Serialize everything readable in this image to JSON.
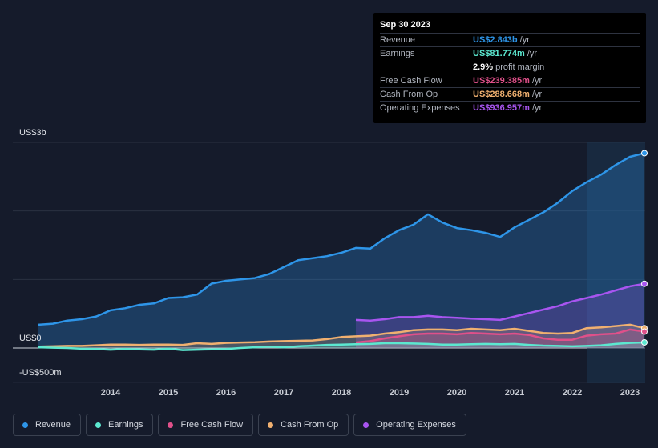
{
  "tooltip": {
    "date": "Sep 30 2023",
    "rows": [
      {
        "label": "Revenue",
        "value": "US$2.843b",
        "unit": "/yr",
        "color": "#2e95e8"
      },
      {
        "label": "Earnings",
        "value": "US$81.774m",
        "unit": "/yr",
        "color": "#5ce8d0"
      },
      {
        "label": "",
        "value": "2.9%",
        "unit": "profit margin",
        "color": "#ffffff"
      },
      {
        "label": "Free Cash Flow",
        "value": "US$239.385m",
        "unit": "/yr",
        "color": "#e0508a"
      },
      {
        "label": "Cash From Op",
        "value": "US$288.668m",
        "unit": "/yr",
        "color": "#f0b070"
      },
      {
        "label": "Operating Expenses",
        "value": "US$936.957m",
        "unit": "/yr",
        "color": "#a855f0"
      }
    ]
  },
  "legend": [
    {
      "label": "Revenue",
      "color": "#2e95e8"
    },
    {
      "label": "Earnings",
      "color": "#5ce8d0"
    },
    {
      "label": "Free Cash Flow",
      "color": "#e0508a"
    },
    {
      "label": "Cash From Op",
      "color": "#f0b070"
    },
    {
      "label": "Operating Expenses",
      "color": "#a855f0"
    }
  ],
  "chart_data": {
    "type": "area",
    "title": "",
    "xlabel": "",
    "ylabel": "",
    "y_tick_labels": [
      "US$3b",
      "US$0",
      "-US$500m"
    ],
    "x_tick_labels": [
      "2014",
      "2015",
      "2016",
      "2017",
      "2018",
      "2019",
      "2020",
      "2021",
      "2022",
      "2023"
    ],
    "ylim": [
      -500,
      3000
    ],
    "xlim": [
      2013.25,
      2023.75
    ],
    "grid": true,
    "legend_position": "bottom",
    "highlight_from": 2022.75,
    "series": [
      {
        "name": "Revenue",
        "color": "#2e95e8",
        "x": [
          2013.25,
          2013.5,
          2013.75,
          2014,
          2014.25,
          2014.5,
          2014.75,
          2015,
          2015.25,
          2015.5,
          2015.75,
          2016,
          2016.25,
          2016.5,
          2016.75,
          2017,
          2017.25,
          2017.5,
          2017.75,
          2018,
          2018.25,
          2018.5,
          2018.75,
          2019,
          2019.25,
          2019.5,
          2019.75,
          2020,
          2020.25,
          2020.5,
          2020.75,
          2021,
          2021.25,
          2021.5,
          2021.75,
          2022,
          2022.25,
          2022.5,
          2022.75,
          2023,
          2023.25,
          2023.5,
          2023.75
        ],
        "values": [
          340,
          355,
          400,
          420,
          460,
          550,
          580,
          630,
          650,
          730,
          740,
          780,
          940,
          980,
          1000,
          1020,
          1080,
          1180,
          1280,
          1310,
          1340,
          1390,
          1460,
          1450,
          1600,
          1720,
          1800,
          1950,
          1830,
          1750,
          1720,
          1680,
          1620,
          1760,
          1870,
          1980,
          2120,
          2290,
          2420,
          2530,
          2670,
          2790,
          2843
        ]
      },
      {
        "name": "Earnings",
        "color": "#5ce8d0",
        "x": [
          2013.25,
          2013.5,
          2013.75,
          2014,
          2014.25,
          2014.5,
          2014.75,
          2015,
          2015.25,
          2015.5,
          2015.75,
          2016,
          2016.25,
          2016.5,
          2016.75,
          2017,
          2017.25,
          2017.5,
          2017.75,
          2018,
          2018.25,
          2018.5,
          2018.75,
          2019,
          2019.25,
          2019.5,
          2019.75,
          2020,
          2020.25,
          2020.5,
          2020.75,
          2021,
          2021.25,
          2021.5,
          2021.75,
          2022,
          2022.25,
          2022.5,
          2022.75,
          2023,
          2023.25,
          2023.5,
          2023.75
        ],
        "values": [
          10,
          5,
          0,
          -10,
          -15,
          -25,
          -15,
          -20,
          -25,
          -10,
          -30,
          -25,
          -20,
          -15,
          0,
          10,
          20,
          10,
          25,
          35,
          45,
          50,
          55,
          60,
          70,
          70,
          65,
          60,
          50,
          50,
          55,
          60,
          55,
          60,
          45,
          35,
          30,
          25,
          30,
          40,
          60,
          75,
          82
        ]
      },
      {
        "name": "Free Cash Flow",
        "color": "#e0508a",
        "x": [
          2018.75,
          2019,
          2019.25,
          2019.5,
          2019.75,
          2020,
          2020.25,
          2020.5,
          2020.75,
          2021,
          2021.25,
          2021.5,
          2021.75,
          2022,
          2022.25,
          2022.5,
          2022.75,
          2023,
          2023.25,
          2023.5,
          2023.75
        ],
        "values": [
          80,
          100,
          140,
          170,
          200,
          210,
          210,
          200,
          220,
          210,
          200,
          210,
          190,
          140,
          120,
          120,
          180,
          200,
          210,
          270,
          239
        ]
      },
      {
        "name": "Cash From Op",
        "color": "#f0b070",
        "x": [
          2013.25,
          2013.5,
          2013.75,
          2014,
          2014.25,
          2014.5,
          2014.75,
          2015,
          2015.25,
          2015.5,
          2015.75,
          2016,
          2016.25,
          2016.5,
          2016.75,
          2017,
          2017.25,
          2017.5,
          2017.75,
          2018,
          2018.25,
          2018.5,
          2018.75,
          2019,
          2019.25,
          2019.5,
          2019.75,
          2020,
          2020.25,
          2020.5,
          2020.75,
          2021,
          2021.25,
          2021.5,
          2021.75,
          2022,
          2022.25,
          2022.5,
          2022.75,
          2023,
          2023.25,
          2023.5,
          2023.75
        ],
        "values": [
          20,
          25,
          30,
          30,
          40,
          50,
          50,
          45,
          50,
          50,
          45,
          70,
          60,
          75,
          80,
          85,
          95,
          100,
          105,
          110,
          130,
          160,
          170,
          180,
          210,
          230,
          260,
          270,
          270,
          260,
          280,
          270,
          260,
          280,
          250,
          220,
          210,
          220,
          290,
          300,
          320,
          340,
          289
        ]
      },
      {
        "name": "Operating Expenses",
        "color": "#a855f0",
        "x": [
          2018.75,
          2019,
          2019.25,
          2019.5,
          2019.75,
          2020,
          2020.25,
          2020.5,
          2020.75,
          2021,
          2021.25,
          2021.5,
          2021.75,
          2022,
          2022.25,
          2022.5,
          2022.75,
          2023,
          2023.25,
          2023.5,
          2023.75
        ],
        "values": [
          410,
          400,
          420,
          450,
          450,
          470,
          450,
          440,
          430,
          420,
          410,
          460,
          510,
          560,
          610,
          680,
          730,
          780,
          840,
          900,
          937
        ]
      }
    ]
  }
}
